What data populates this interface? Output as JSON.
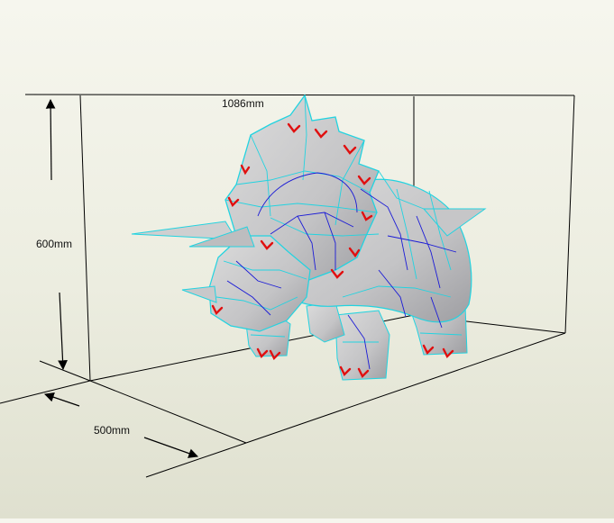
{
  "viewer": {
    "background_top": "#f6f6ee",
    "background_bottom": "#dfe0cf",
    "model_fill": "#c9c9c9",
    "model_shade": "#a9a9ab",
    "fold_edge_color": "#22d3e0",
    "inner_edge_color": "#1b1bd6",
    "glue_mark_color": "#e01010",
    "box_line_color": "#000000"
  },
  "dimensions": {
    "length": "1086mm",
    "height": "600mm",
    "depth": "500mm"
  },
  "model": {
    "icon": "triceratops-papercraft-model"
  }
}
